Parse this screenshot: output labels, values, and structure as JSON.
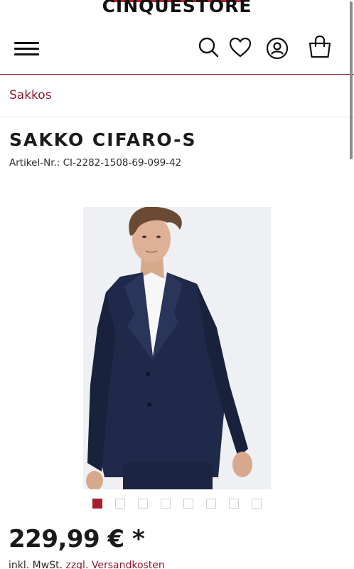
{
  "header": {
    "logo": "CINQUESTORE",
    "icons": [
      "menu-icon",
      "search-icon",
      "heart-icon",
      "user-icon",
      "shopping-bag-icon"
    ]
  },
  "breadcrumb": {
    "label": "Sakkos"
  },
  "product": {
    "title": "SAKKO CIFARO-S",
    "sku": "Artikel-Nr.: CI-2282-1508-69-099-42",
    "image_count": 8,
    "active_image": 1,
    "price": "229,99 € *",
    "tax_prefix": "inkl. MwSt.",
    "shipping_link": "zzgl. Versandkosten"
  },
  "colors": {
    "accent": "#8b1a2b",
    "active_dot": "#a71f2c",
    "jacket": "#1f2a4a"
  }
}
